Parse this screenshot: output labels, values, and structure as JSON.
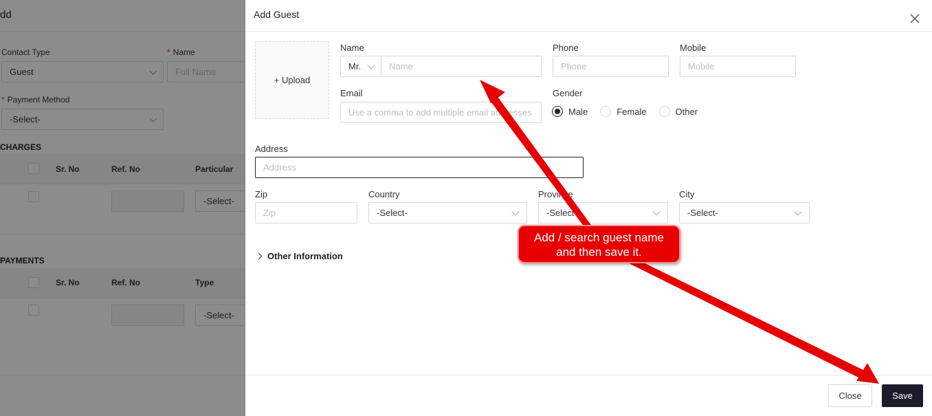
{
  "background": {
    "title": "dd",
    "contact_type": {
      "label": "Contact Type",
      "value": "Guest"
    },
    "name": {
      "required": "*",
      "label": "Name",
      "placeholder": "Full Name"
    },
    "payment_method": {
      "required": "*",
      "label": "Payment Method",
      "value": "-Select-"
    },
    "charges": {
      "title": "CHARGES",
      "columns": [
        "Sr. No",
        "Ref. No",
        "Particular"
      ],
      "row_select": "-Select-"
    },
    "payments": {
      "title": "PAYMENTS",
      "columns": [
        "Sr. No",
        "Ref. No",
        "Type"
      ],
      "row_select": "-Select-"
    }
  },
  "drawer": {
    "title": "Add Guest",
    "upload_label": "+ Upload",
    "name": {
      "label": "Name",
      "salutation": "Mr.",
      "placeholder": "Name"
    },
    "phone": {
      "label": "Phone",
      "placeholder": "Phone"
    },
    "mobile": {
      "label": "Mobile",
      "placeholder": "Mobile"
    },
    "email": {
      "label": "Email",
      "placeholder": "Use a comma to add multiple email addresses"
    },
    "gender": {
      "label": "Gender",
      "options": [
        "Male",
        "Female",
        "Other"
      ],
      "selected": "Male"
    },
    "address": {
      "label": "Address",
      "placeholder": "Address"
    },
    "zip": {
      "label": "Zip",
      "placeholder": "Zip"
    },
    "country": {
      "label": "Country",
      "value": "-Select-"
    },
    "province": {
      "label": "Province",
      "value": "-Select-"
    },
    "city": {
      "label": "City",
      "value": "-Select-"
    },
    "other_information": "Other Information",
    "close_button": "Close",
    "save_button": "Save"
  },
  "annotation": {
    "callout_line1": "Add / search guest name",
    "callout_line2": "and then save it.",
    "color": "#e60000"
  }
}
